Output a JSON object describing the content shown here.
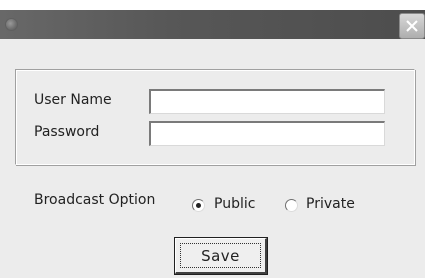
{
  "window": {
    "title": ""
  },
  "icons": {
    "app": "app-icon",
    "close": "close-icon"
  },
  "colors": {
    "titlebar": "#5a5a5a",
    "background": "#ececec"
  },
  "credentials": {
    "username_label": "User Name",
    "username_value": "",
    "password_label": "Password",
    "password_value": ""
  },
  "broadcast": {
    "label": "Broadcast Option",
    "options": [
      {
        "label": "Public",
        "selected": true
      },
      {
        "label": "Private",
        "selected": false
      }
    ]
  },
  "actions": {
    "save_label": "Save"
  }
}
